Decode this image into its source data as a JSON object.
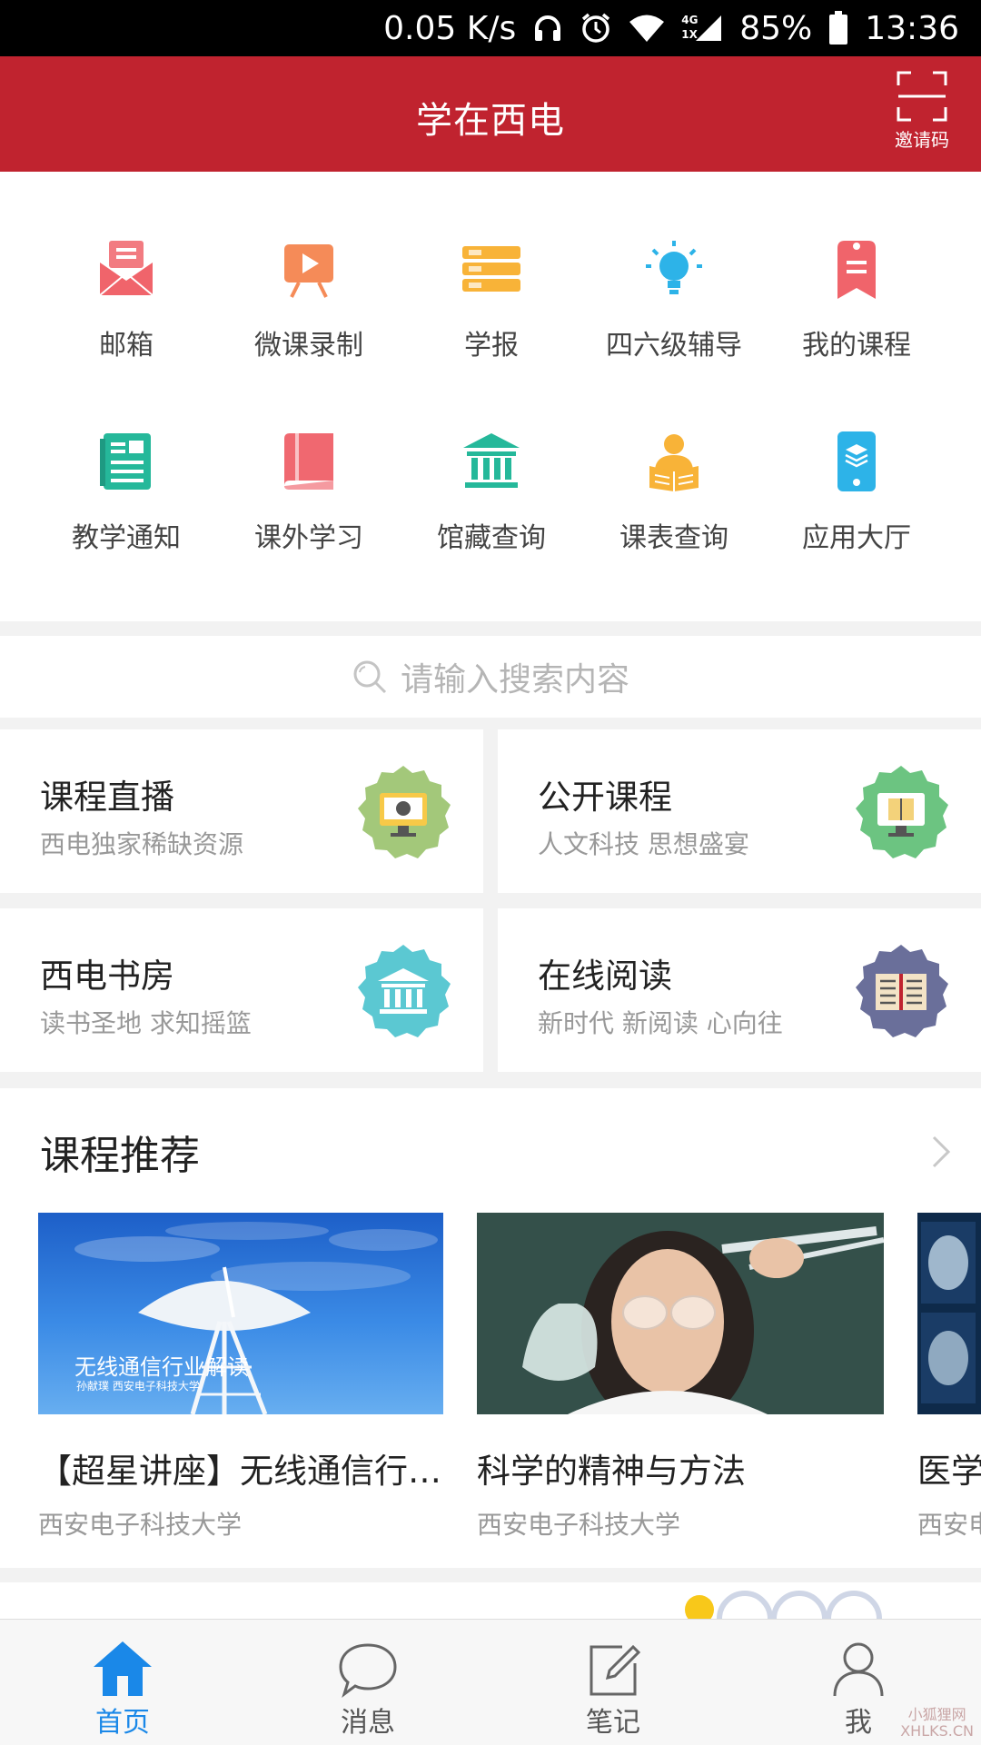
{
  "status_bar": {
    "speed": "0.05 K/s",
    "network": "4G",
    "network2": "1X",
    "battery": "85%",
    "time": "13:36"
  },
  "header": {
    "title": "学在西电",
    "invite_label": "邀请码",
    "color": "#c0232f"
  },
  "grid": [
    {
      "label": "邮箱",
      "icon": "mail-icon",
      "color": "#f0646b"
    },
    {
      "label": "微课录制",
      "icon": "video-record-icon",
      "color": "#f58b58"
    },
    {
      "label": "学报",
      "icon": "books-icon",
      "color": "#f8b338"
    },
    {
      "label": "四六级辅导",
      "icon": "lightbulb-icon",
      "color": "#2db3e8"
    },
    {
      "label": "我的课程",
      "icon": "bookmark-icon",
      "color": "#f0646b"
    },
    {
      "label": "教学通知",
      "icon": "notice-icon",
      "color": "#25b89a"
    },
    {
      "label": "课外学习",
      "icon": "book-icon",
      "color": "#f06870"
    },
    {
      "label": "馆藏查询",
      "icon": "library-icon",
      "color": "#25b89a"
    },
    {
      "label": "课表查询",
      "icon": "reader-icon",
      "color": "#f8b338"
    },
    {
      "label": "应用大厅",
      "icon": "app-phone-icon",
      "color": "#2db3e8"
    }
  ],
  "search": {
    "placeholder": "请输入搜索内容"
  },
  "cards": [
    {
      "title": "课程直播",
      "subtitle": "西电独家稀缺资源",
      "color": "#a3c87a"
    },
    {
      "title": "公开课程",
      "subtitle": "人文科技 思想盛宴",
      "color": "#6cc481"
    },
    {
      "title": "西电书房",
      "subtitle": "读书圣地 求知摇篮",
      "color": "#5bc8d2"
    },
    {
      "title": "在线阅读",
      "subtitle": "新时代 新阅读 心向往",
      "color": "#6a6f9a"
    }
  ],
  "recommend": {
    "title": "课程推荐",
    "items": [
      {
        "title": "【超星讲座】无线通信行业解读",
        "source": "西安电子科技大学",
        "thumb_text": "无线通信行业解读",
        "thumb_sub": "孙献璞 西安电子科技大学"
      },
      {
        "title": "科学的精神与方法",
        "source": "西安电子科技大学"
      },
      {
        "title": "医学",
        "source": "西安电"
      }
    ]
  },
  "tabs": [
    {
      "label": "首页",
      "icon": "home-icon",
      "active": true
    },
    {
      "label": "消息",
      "icon": "chat-bubble-icon",
      "active": false
    },
    {
      "label": "笔记",
      "icon": "note-edit-icon",
      "active": false
    },
    {
      "label": "我",
      "icon": "user-icon",
      "active": false
    }
  ],
  "watermark": {
    "line1": "小狐狸网",
    "line2": "XHLKS.CN"
  }
}
